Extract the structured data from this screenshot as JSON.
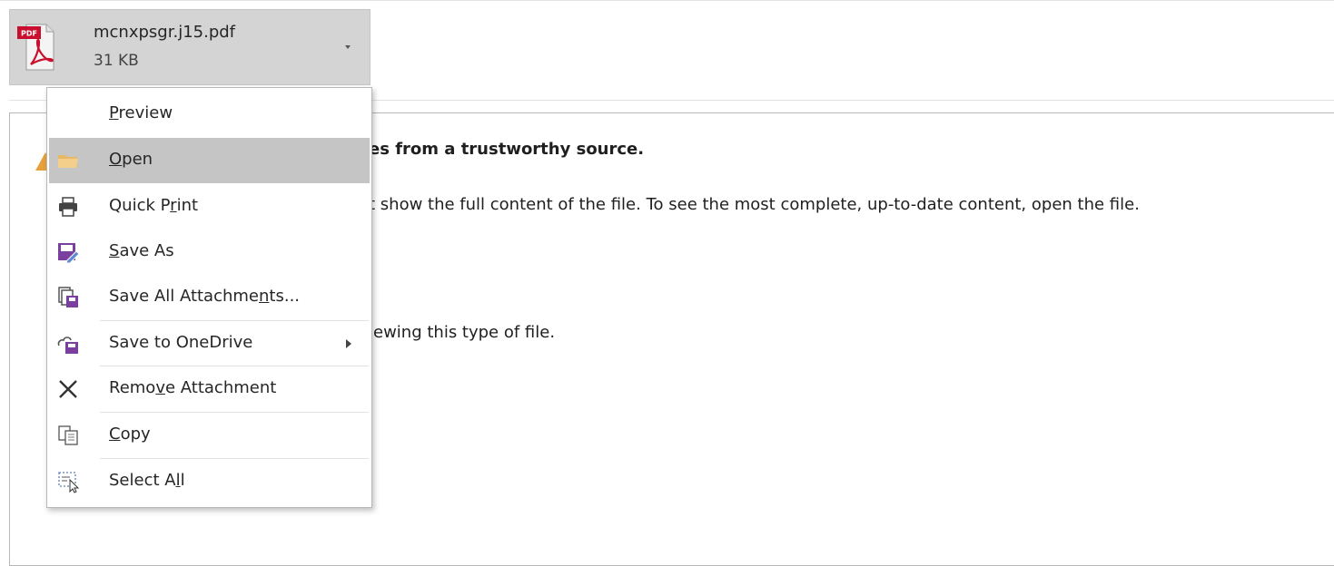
{
  "attachment": {
    "file_type_badge": "PDF",
    "file_name": "mcnxpsgr.j15.pdf",
    "file_size": "31 KB"
  },
  "preview": {
    "warning_line": "es from a trustworthy source.",
    "info_line": "t show the full content of the file. To see the most complete, up-to-date content, open the file.",
    "viewer_line": "iewing this type of file."
  },
  "context_menu": {
    "items": [
      {
        "pre": "",
        "key": "P",
        "post": "review",
        "icon": "none"
      },
      {
        "pre": "",
        "key": "O",
        "post": "pen",
        "icon": "folder-icon"
      },
      {
        "pre": "Quick P",
        "key": "r",
        "post": "int",
        "icon": "printer-icon"
      },
      {
        "pre": "",
        "key": "S",
        "post": "ave As",
        "icon": "save-as-icon"
      },
      {
        "pre": "Save All Attachme",
        "key": "n",
        "post": "ts...",
        "icon": "save-all-icon"
      },
      {
        "pre": "Save to OneDrive",
        "key": "",
        "post": "",
        "icon": "save-onedrive-icon"
      },
      {
        "pre": "Remo",
        "key": "v",
        "post": "e Attachment",
        "icon": "remove-icon"
      },
      {
        "pre": "",
        "key": "C",
        "post": "opy",
        "icon": "copy-icon"
      },
      {
        "pre": "Select A",
        "key": "l",
        "post": "l",
        "icon": "select-all-icon"
      }
    ]
  },
  "colors": {
    "chip_bg": "#d4d4d4",
    "menu_highlight": "#c5c5c5",
    "pdf_red": "#c8102e",
    "folder_yellow": "#e9b867",
    "save_purple": "#7b3fa0"
  }
}
